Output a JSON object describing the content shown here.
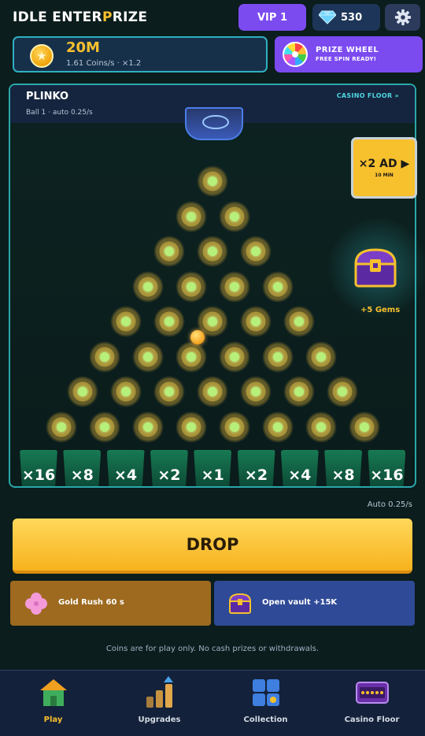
{
  "header": {
    "title_part1": "IDLE ENTER",
    "title_accent": "P",
    "title_part2": "RIZE",
    "vip_label": "VIP 1",
    "gems": "530"
  },
  "coins": {
    "amount": "20M",
    "rate": "1.61 Coins/s  ·  ×1.2"
  },
  "prize_wheel": {
    "title": "PRIZE WHEEL",
    "subtitle": "FREE SPIN READY!"
  },
  "board": {
    "title": "PLINKO",
    "ball_info": "Ball 1  ·  auto 0.25/s",
    "casino_link": "CASINO FLOOR »",
    "slots": [
      "×16",
      "×8",
      "×4",
      "×2",
      "×1",
      "×2",
      "×4",
      "×8",
      "×16"
    ]
  },
  "ad": {
    "main": "×2 AD ▶",
    "sub": "10 MIN"
  },
  "chest": {
    "label": "+5 Gems"
  },
  "auto_rate": "Auto 0.25/s",
  "drop_label": "DROP",
  "boosts": {
    "rush_label": "Gold Rush 60 s",
    "vault_label": "Open vault +15K"
  },
  "disclaimer": "Coins are for play only. No cash prizes or withdrawals.",
  "nav": {
    "items": [
      {
        "label": "Play",
        "icon": "house-icon"
      },
      {
        "label": "Upgrades",
        "icon": "bars-icon"
      },
      {
        "label": "Collection",
        "icon": "grid-icon"
      },
      {
        "label": "Casino Floor",
        "icon": "casino-sign-icon"
      }
    ],
    "active": "Play"
  },
  "colors": {
    "accent": "#f7c02d",
    "purple": "#7b4bf0",
    "board_border": "#2aa7ab"
  }
}
